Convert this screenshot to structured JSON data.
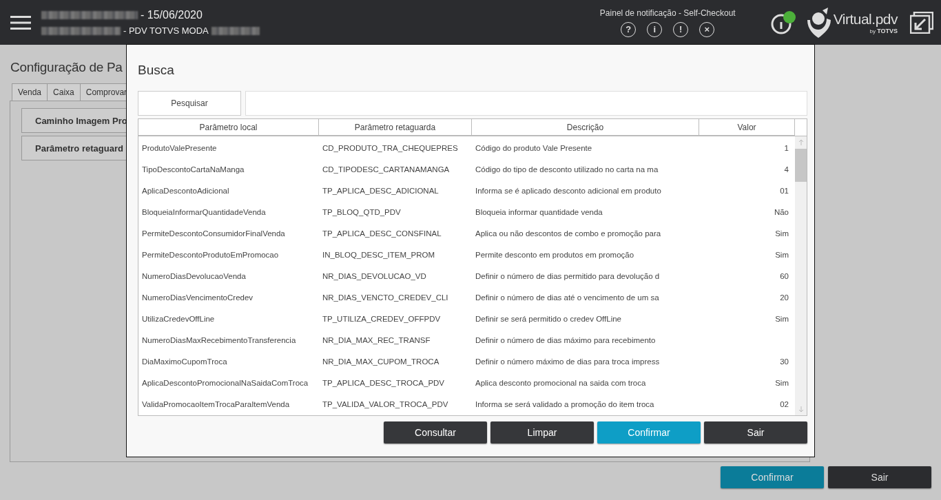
{
  "header": {
    "date": "- 15/06/2020",
    "store": "- PDV TOTVS MODA",
    "notification_title": "Painel de notificação - Self-Checkout",
    "notification_icons": [
      "?",
      "i",
      "!",
      "×"
    ],
    "status_online": true,
    "logo": {
      "name": "Virtual",
      "suffix": ".pdv",
      "by": "by",
      "brand": "TOTVS"
    }
  },
  "page": {
    "title": "Configuração de Pa",
    "tabs": [
      {
        "label": "Venda",
        "selected": false
      },
      {
        "label": "Caixa",
        "selected": false
      },
      {
        "label": "Comprovar",
        "selected": false
      }
    ],
    "items": [
      "Caminho Imagem Pro",
      "Parâmetro retaguard"
    ],
    "buttons": [
      {
        "label": "Confirmar",
        "kind": "primary"
      },
      {
        "label": "Sair",
        "kind": "dark"
      }
    ]
  },
  "dialog": {
    "title": "Busca",
    "search_button": "Pesquisar",
    "table": {
      "columns": [
        "Parâmetro local",
        "Parâmetro retaguarda",
        "Descrição",
        "Valor"
      ],
      "rows": [
        [
          "ProdutoValePresente",
          "CD_PRODUTO_TRA_CHEQUEPRES",
          "Código do produto Vale Presente",
          "1"
        ],
        [
          "TipoDescontoCartaNaManga",
          "CD_TIPODESC_CARTANAMANGA",
          "Código do tipo de desconto utilizado no carta na ma",
          "4"
        ],
        [
          "AplicaDescontoAdicional",
          "TP_APLICA_DESC_ADICIONAL",
          "Informa se é aplicado desconto adicional em produto",
          "01"
        ],
        [
          "BloqueiaInformarQuantidadeVenda",
          "TP_BLOQ_QTD_PDV",
          "Bloqueia informar quantidade venda",
          "Não"
        ],
        [
          "PermiteDescontoConsumidorFinalVenda",
          "TP_APLICA_DESC_CONSFINAL",
          "Aplica ou não descontos de combo e promoção para",
          "Sim"
        ],
        [
          "PermiteDescontoProdutoEmPromocao",
          "IN_BLOQ_DESC_ITEM_PROM",
          "Permite desconto em produtos em promoção",
          "Sim"
        ],
        [
          "NumeroDiasDevolucaoVenda",
          "NR_DIAS_DEVOLUCAO_VD",
          "Definir o número de dias permitido para devolução d",
          "60"
        ],
        [
          "NumeroDiasVencimentoCredev",
          "NR_DIAS_VENCTO_CREDEV_CLI",
          "Definir o número de dias até o vencimento de um sa",
          "20"
        ],
        [
          "UtilizaCredevOffLine",
          "TP_UTILIZA_CREDEV_OFFPDV",
          "Definir se será permitido o credev OffLine",
          "Sim"
        ],
        [
          "NumeroDiasMaxRecebimentoTransferencia",
          "NR_DIA_MAX_REC_TRANSF",
          "Definir o número de dias máximo para recebimento",
          null
        ],
        [
          "DiaMaximoCupomTroca",
          "NR_DIA_MAX_CUPOM_TROCA",
          "Definir o número máximo de dias para troca impress",
          "30"
        ],
        [
          "AplicaDescontoPromocionalNaSaidaComTroca",
          "TP_APLICA_DESC_TROCA_PDV",
          "Aplica desconto promocional na saida com troca",
          "Sim"
        ],
        [
          "ValidaPromocaoItemTrocaParaItemVenda",
          "TP_VALIDA_VALOR_TROCA_PDV",
          "Informa se será validado a promoção do item troca",
          "02"
        ]
      ]
    },
    "buttons": [
      {
        "label": "Consultar",
        "kind": "dark"
      },
      {
        "label": "Limpar",
        "kind": "dark"
      },
      {
        "label": "Confirmar",
        "kind": "primary"
      },
      {
        "label": "Sair",
        "kind": "dark"
      }
    ]
  }
}
